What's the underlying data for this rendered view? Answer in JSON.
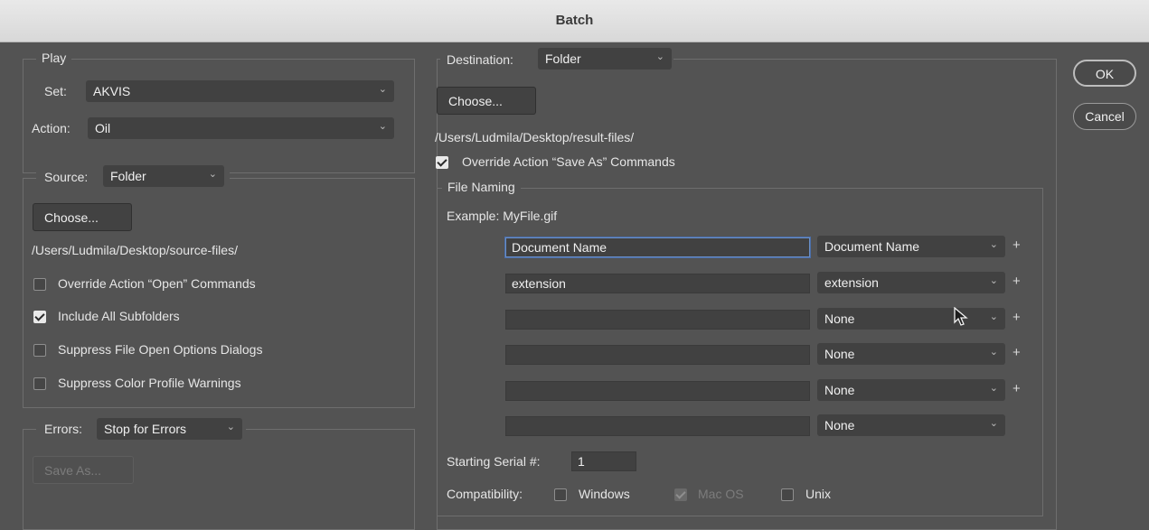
{
  "window": {
    "title": "Batch"
  },
  "play": {
    "legend": "Play",
    "set_label": "Set:",
    "set_value": "AKVIS",
    "action_label": "Action:",
    "action_value": "Oil"
  },
  "source": {
    "label": "Source:",
    "value": "Folder",
    "choose_label": "Choose...",
    "path": "/Users/Ludmila/Desktop/source-files/",
    "options": [
      {
        "label": "Override Action “Open” Commands",
        "checked": false
      },
      {
        "label": "Include All Subfolders",
        "checked": true
      },
      {
        "label": "Suppress File Open Options Dialogs",
        "checked": false
      },
      {
        "label": "Suppress Color Profile Warnings",
        "checked": false
      }
    ]
  },
  "errors": {
    "label": "Errors:",
    "value": "Stop for Errors",
    "save_as_label": "Save As..."
  },
  "destination": {
    "label": "Destination:",
    "value": "Folder",
    "choose_label": "Choose...",
    "path": "/Users/Ludmila/Desktop/result-files/",
    "override_label": "Override Action “Save As” Commands",
    "override_checked": true
  },
  "file_naming": {
    "legend": "File Naming",
    "example": "Example: MyFile.gif",
    "rows": [
      {
        "text": "Document Name",
        "select": "Document Name"
      },
      {
        "text": "extension",
        "select": "extension"
      },
      {
        "text": "",
        "select": "None"
      },
      {
        "text": "",
        "select": "None"
      },
      {
        "text": "",
        "select": "None"
      },
      {
        "text": "",
        "select": "None"
      }
    ],
    "serial_label": "Starting Serial #:",
    "serial_value": "1",
    "compat_label": "Compatibility:",
    "compat_windows": "Windows",
    "compat_macos": "Mac OS",
    "compat_unix": "Unix"
  },
  "buttons": {
    "ok": "OK",
    "cancel": "Cancel"
  },
  "icons": {
    "chevron": "chevron-down-icon",
    "plus": "plus-icon",
    "check": "checkmark-icon",
    "cursor": "mouse-pointer-icon"
  }
}
